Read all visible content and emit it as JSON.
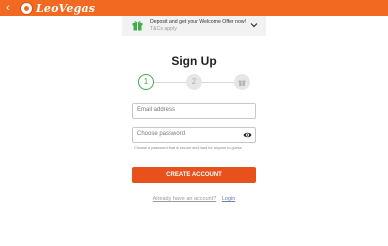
{
  "header": {
    "brand": "LeoVegas",
    "colors": {
      "brand": "#f26a21"
    }
  },
  "promo": {
    "text": "Deposit and get your Welcome Offer now!",
    "terms": "T&Cs apply"
  },
  "page": {
    "title": "Sign Up",
    "steps": [
      "1",
      "2",
      ""
    ]
  },
  "form": {
    "email_placeholder": "Email address",
    "password_placeholder": "Choose password",
    "password_hint": "Choose a password that is secure and hard for anyone to guess.",
    "submit_label": "CREATE ACCOUNT"
  },
  "footer": {
    "question": "Already have an account?",
    "login_label": "Login"
  }
}
